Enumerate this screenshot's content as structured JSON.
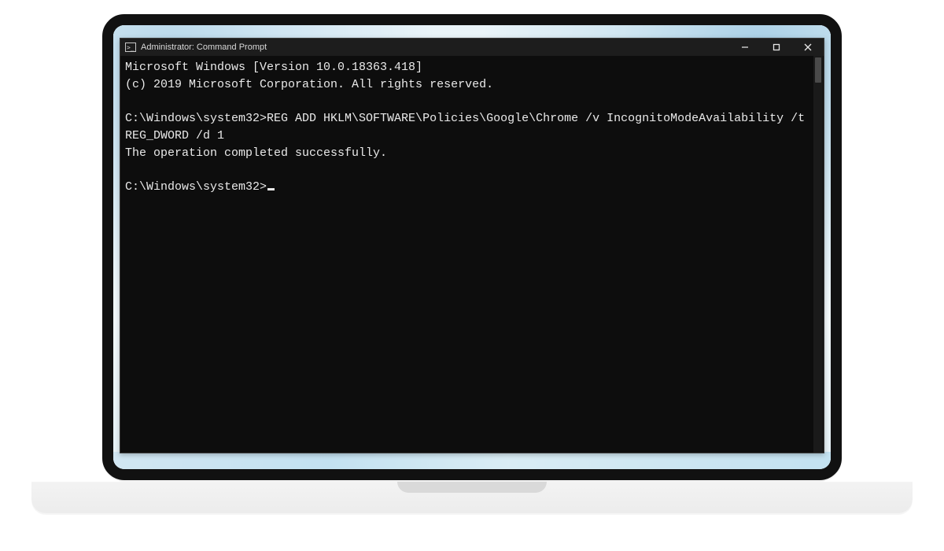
{
  "window": {
    "title": "Administrator: Command Prompt"
  },
  "terminal": {
    "header_line1": "Microsoft Windows [Version 10.0.18363.418]",
    "header_line2": "(c) 2019 Microsoft Corporation. All rights reserved.",
    "prompt1_path": "C:\\Windows\\system32>",
    "prompt1_command": "REG ADD HKLM\\SOFTWARE\\Policies\\Google\\Chrome /v IncognitoModeAvailability /t REG_DWORD /d 1",
    "result_line": "The operation completed successfully.",
    "prompt2_path": "C:\\Windows\\system32>"
  }
}
